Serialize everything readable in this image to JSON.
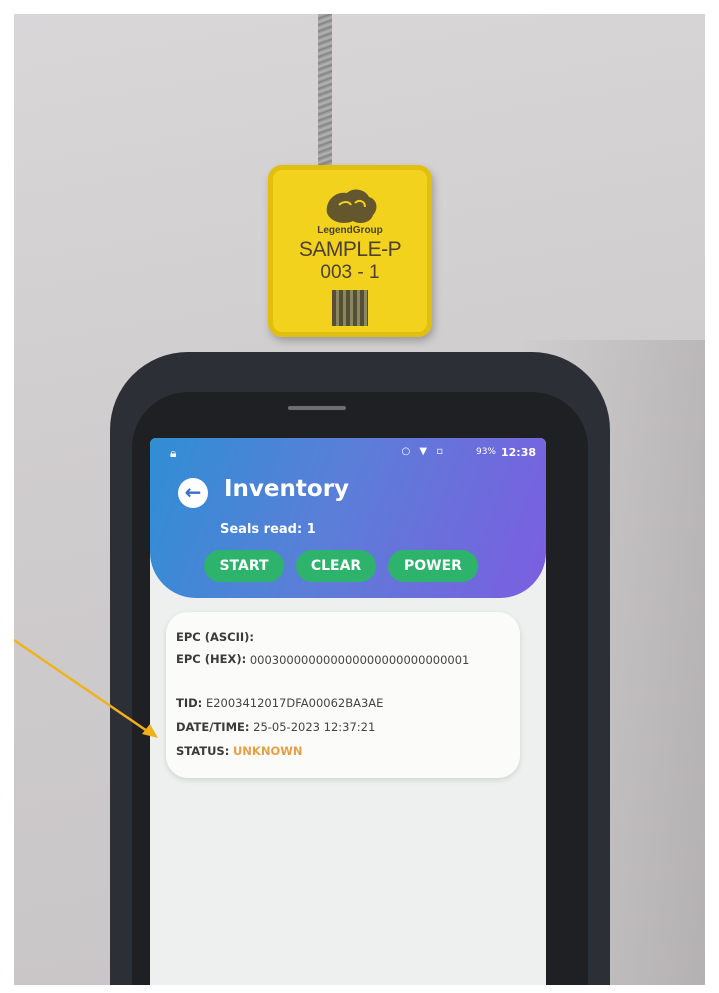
{
  "tag": {
    "brand": "LegendGroup",
    "line1": "SAMPLE-P",
    "line2": "003 - 1"
  },
  "status_bar": {
    "lock_icon": "lock-icon",
    "battery": "93%",
    "time": "12:38"
  },
  "app": {
    "title": "Inventory",
    "seals_read": "Seals read: 1",
    "buttons": {
      "start": "START",
      "clear": "CLEAR",
      "power": "POWER"
    }
  },
  "record": {
    "epc_ascii_label": "EPC (ASCII):",
    "epc_ascii_value": "",
    "epc_hex_label": "EPC (HEX):",
    "epc_hex_value": "000300000000000000000000000001",
    "tid_label": "TID:",
    "tid_value": "E2003412017DFA00062BA3AE",
    "datetime_label": "DATE/TIME:",
    "datetime_value": "25-05-2023 12:37:21",
    "status_label": "STATUS:",
    "status_value": "UNKNOWN"
  },
  "colors": {
    "accent_green": "#2db36b",
    "header_blue": "#2f8ed4",
    "header_purple": "#7b5ee0",
    "status_unknown": "#e5a045",
    "annotation_arrow": "#f0b21c"
  }
}
